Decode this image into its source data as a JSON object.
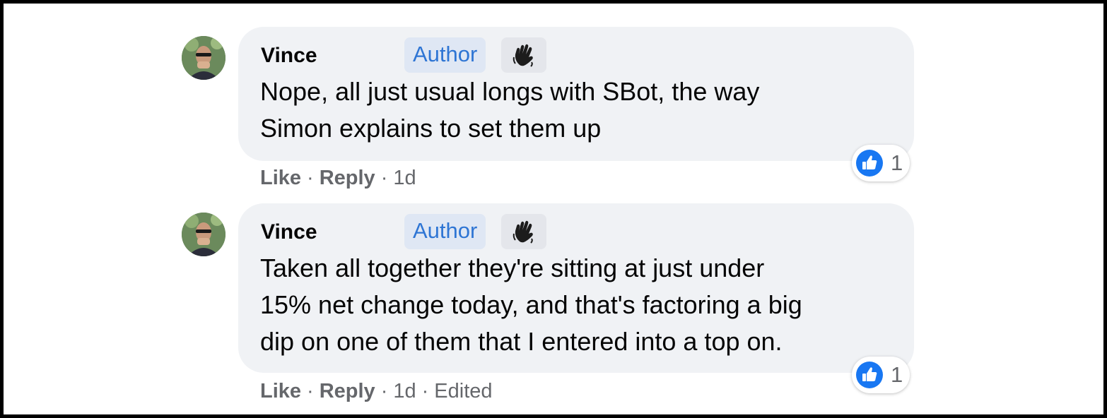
{
  "comments": [
    {
      "author": "Vince",
      "badge": "Author",
      "badge_icon": "waving-hand-icon",
      "text": "Nope, all just usual longs with SBot, the way\nSimon explains to set them up",
      "reaction": {
        "icon": "like-icon",
        "count": "1"
      },
      "actions": {
        "like": "Like",
        "reply": "Reply",
        "time": "1d",
        "edited": ""
      }
    },
    {
      "author": "Vince",
      "badge": "Author",
      "badge_icon": "waving-hand-icon",
      "text": "Taken all together they're sitting at just under\n15% net change today, and that's factoring a big\ndip on one of them that I entered into a top on.",
      "reaction": {
        "icon": "like-icon",
        "count": "1"
      },
      "actions": {
        "like": "Like",
        "reply": "Reply",
        "time": "1d",
        "edited": "Edited"
      }
    }
  ],
  "colors": {
    "bubble": "#f0f2f5",
    "badge_text": "#2e75d4",
    "like_blue": "#1877f2",
    "meta_text": "#65676b"
  }
}
